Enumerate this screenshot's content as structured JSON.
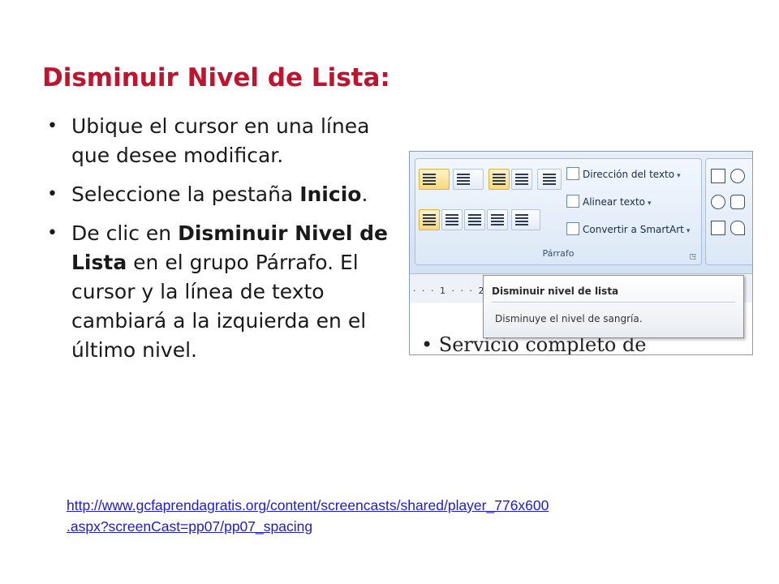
{
  "slide": {
    "title": "Disminuir Nivel de Lista:",
    "bullets": [
      {
        "pre": "Ubique el cursor en una línea que desee modificar.",
        "bold": "",
        "post": ""
      },
      {
        "pre": "Seleccione la pestaña ",
        "bold": "Inicio",
        "post": "."
      },
      {
        "pre": "De clic en ",
        "bold": "Disminuir Nivel de Lista",
        "post": " en el grupo Párrafo. El cursor y la línea de texto cambiará a la izquierda en el último nivel."
      }
    ],
    "link_line1": "http://www.gcfaprendagratis.org/content/screencasts/shared/player_776x600",
    "link_line2": ".aspx?screenCast=pp07/pp07_spacing"
  },
  "screenshot": {
    "commands": [
      "Dirección del texto",
      "Alinear texto",
      "Convertir a SmartArt"
    ],
    "group_label": "Párrafo",
    "ruler_text": "· · · 1 · · · 2",
    "tooltip_title": "Disminuir nivel de lista",
    "tooltip_desc": "Disminuye el nivel de sangría.",
    "doc_text": "•  Servicio completo de"
  },
  "colors": {
    "title": "#c0142e",
    "link": "#1c1cd6",
    "ribbon": "#dfe9f6"
  }
}
